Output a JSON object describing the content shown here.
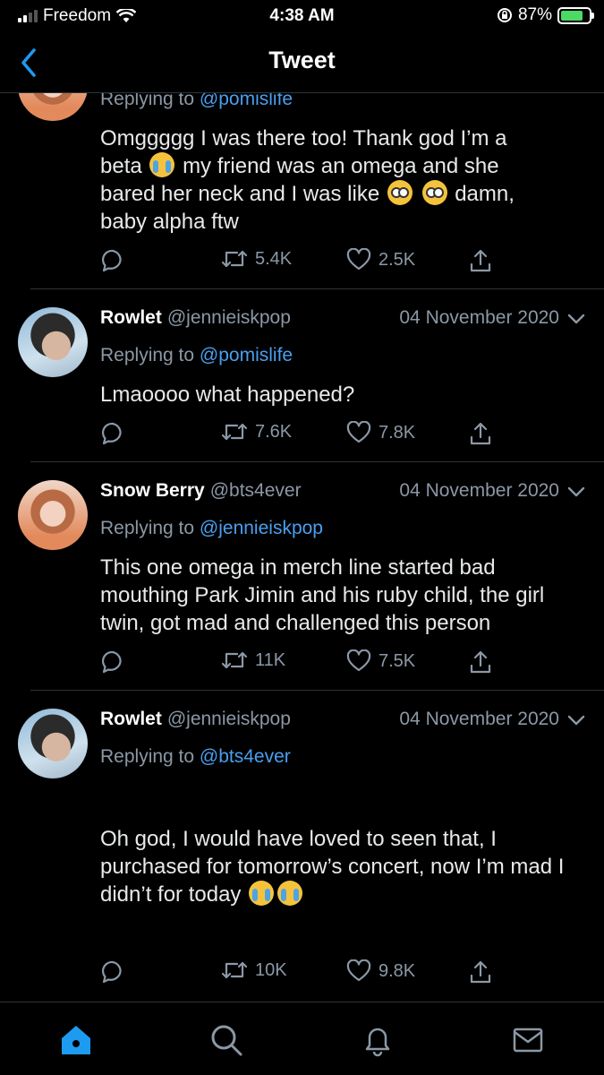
{
  "status": {
    "carrier": "Freedom",
    "time": "4:38 AM",
    "battery": "87%"
  },
  "nav": {
    "title": "Tweet"
  },
  "tweets": [
    {
      "reply_prefix": "Replying to",
      "reply_to": "@pomislife",
      "lines": [
        "Omggggg I was there too! Thank god I’m a",
        "beta",
        "my friend was an omega and she",
        "bared her neck and I was like",
        "damn,",
        "baby alpha ftw"
      ],
      "retweets": "5.4K",
      "likes": "2.5K"
    },
    {
      "name": "Rowlet",
      "handle": "@jennieiskpop",
      "date": "04 November 2020",
      "reply_prefix": "Replying to",
      "reply_to": "@pomislife",
      "text": "Lmaoooo what happened?",
      "retweets": "7.6K",
      "likes": "7.8K"
    },
    {
      "name": "Snow Berry",
      "handle": "@bts4ever",
      "date": "04 November 2020",
      "reply_prefix": "Replying to",
      "reply_to": "@jennieiskpop",
      "text": "This one omega in merch line started bad mouthing Park Jimin and his ruby child, the girl twin, got mad and challenged this person",
      "retweets": "11K",
      "likes": "7.5K"
    },
    {
      "name": "Rowlet",
      "handle": "@jennieiskpop",
      "date": "04 November 2020",
      "reply_prefix": "Replying to",
      "reply_to": "@bts4ever",
      "text": "Oh god, I would have loved to seen that, I purchased for tomorrow’s concert, now I’m mad I didn’t for today",
      "retweets": "10K",
      "likes": "9.8K"
    }
  ],
  "icons": [
    "back-chevron-icon",
    "reply-icon",
    "retweet-icon",
    "like-icon",
    "share-icon",
    "home-icon",
    "search-icon",
    "notifications-icon",
    "messages-icon"
  ],
  "colors": {
    "link": "#4a9ff0",
    "background": "#000000",
    "muted": "#8b98a5"
  }
}
